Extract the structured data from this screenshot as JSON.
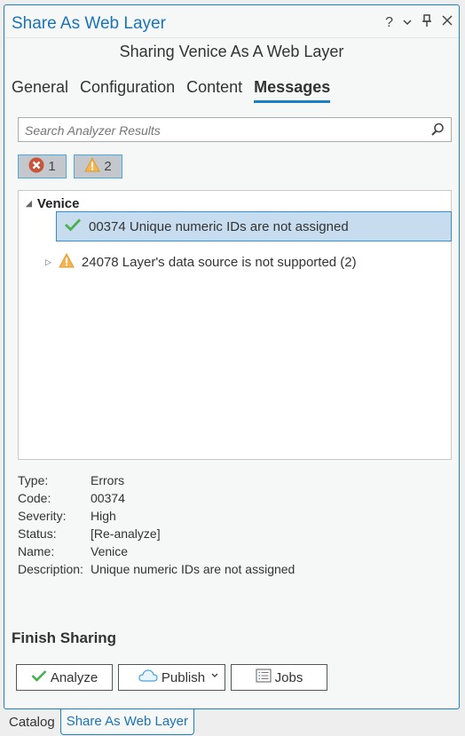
{
  "window": {
    "title": "Share As Web Layer",
    "controls": {
      "help": "?",
      "menu": "⌄",
      "pin": "⊥",
      "close": "✕"
    }
  },
  "header": {
    "subtitle": "Sharing Venice As A Web Layer"
  },
  "tabs": [
    {
      "label": "General",
      "active": false
    },
    {
      "label": "Configuration",
      "active": false
    },
    {
      "label": "Content",
      "active": false
    },
    {
      "label": "Messages",
      "active": true
    }
  ],
  "search": {
    "placeholder": "Search Analyzer Results",
    "value": ""
  },
  "filters": {
    "errors_count": "1",
    "warnings_count": "2"
  },
  "tree": {
    "root_label": "Venice",
    "items": [
      {
        "icon": "check-icon",
        "label": "00374 Unique numeric IDs are not assigned",
        "selected": true
      },
      {
        "icon": "warning-icon",
        "label": "24078 Layer's data source is not supported (2)",
        "selected": false
      }
    ]
  },
  "details": [
    {
      "key": "Type:",
      "value": "Errors"
    },
    {
      "key": "Code:",
      "value": "00374"
    },
    {
      "key": "Severity:",
      "value": "High"
    },
    {
      "key": "Status:",
      "value": "[Re-analyze]"
    },
    {
      "key": "Name:",
      "value": "Venice"
    },
    {
      "key": "Description:",
      "value": "Unique numeric IDs are not assigned"
    }
  ],
  "finish": {
    "heading": "Finish Sharing",
    "analyze_label": "Analyze",
    "publish_label": "Publish",
    "jobs_label": "Jobs"
  },
  "bottom_tabs": [
    {
      "label": "Catalog",
      "active": false
    },
    {
      "label": "Share As Web Layer",
      "active": true
    }
  ],
  "colors": {
    "accent": "#1b7fc4",
    "selection": "#c7dcee",
    "error": "#c8553a",
    "warning": "#f0a63c",
    "success": "#4caf50"
  }
}
